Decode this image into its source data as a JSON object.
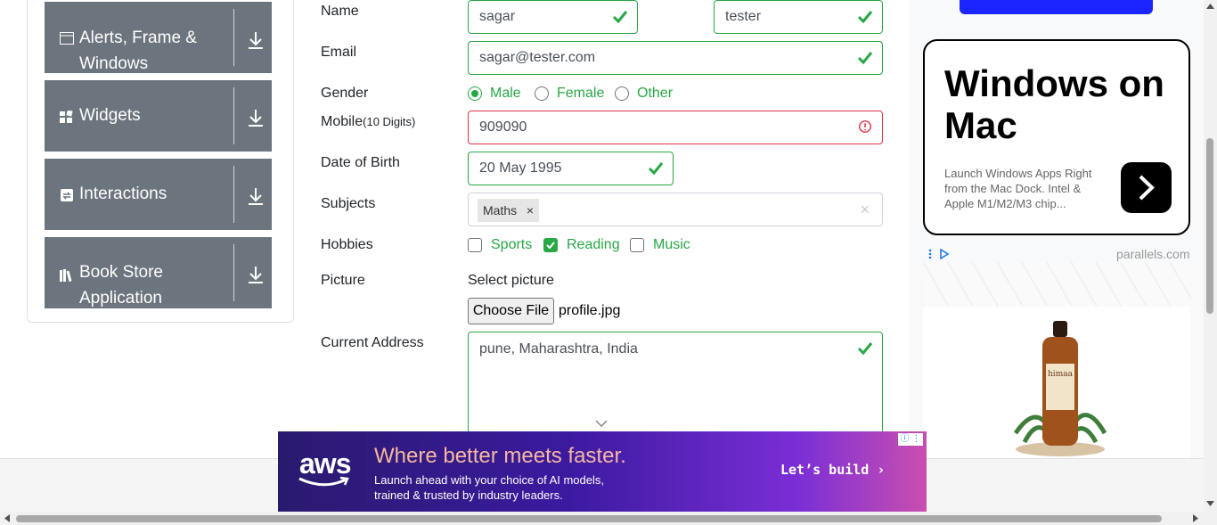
{
  "sidebar": {
    "items": [
      {
        "label": "Alerts, Frame &",
        "label2": "Windows",
        "icon": "window-icon"
      },
      {
        "label": "Widgets",
        "icon": "widgets-icon"
      },
      {
        "label": "Interactions",
        "icon": "interactions-icon"
      },
      {
        "label": "Book Store",
        "label2": "Application",
        "icon": "books-icon"
      }
    ]
  },
  "form": {
    "name_label": "Name",
    "first_name": "sagar",
    "last_name": "tester",
    "email_label": "Email",
    "email": "sagar@tester.com",
    "gender_label": "Gender",
    "gender_options": [
      "Male",
      "Female",
      "Other"
    ],
    "gender_selected": "Male",
    "mobile_label": "Mobile",
    "mobile_hint": "(10 Digits)",
    "mobile": "909090",
    "dob_label": "Date of Birth",
    "dob": "20 May 1995",
    "subjects_label": "Subjects",
    "subjects": [
      "Maths"
    ],
    "subject_remove": "×",
    "subjects_clear": "×",
    "hobbies_label": "Hobbies",
    "hobbies": [
      {
        "label": "Sports",
        "checked": false
      },
      {
        "label": "Reading",
        "checked": true
      },
      {
        "label": "Music",
        "checked": false
      }
    ],
    "picture_label": "Picture",
    "picture_prompt": "Select picture",
    "file_button": "Choose File",
    "file_name": "profile.jpg",
    "address_label": "Current Address",
    "address": "pune, Maharashtra, India"
  },
  "ads": {
    "side_headline": "Windows on Mac",
    "side_text": "Launch Windows Apps Right from the Mac Dock. Intel & Apple M1/M2/M3 chip...",
    "side_brand": "parallels.com",
    "banner_logo": "aws",
    "banner_headline": "Where better meets faster.",
    "banner_text": "Launch ahead with your choice of AI models, trained & trusted by industry leaders.",
    "banner_cta": "Let’s build ›"
  },
  "colors": {
    "valid": "#28a745",
    "invalid": "#dc3545",
    "sidebar_bg": "#6c757d"
  }
}
